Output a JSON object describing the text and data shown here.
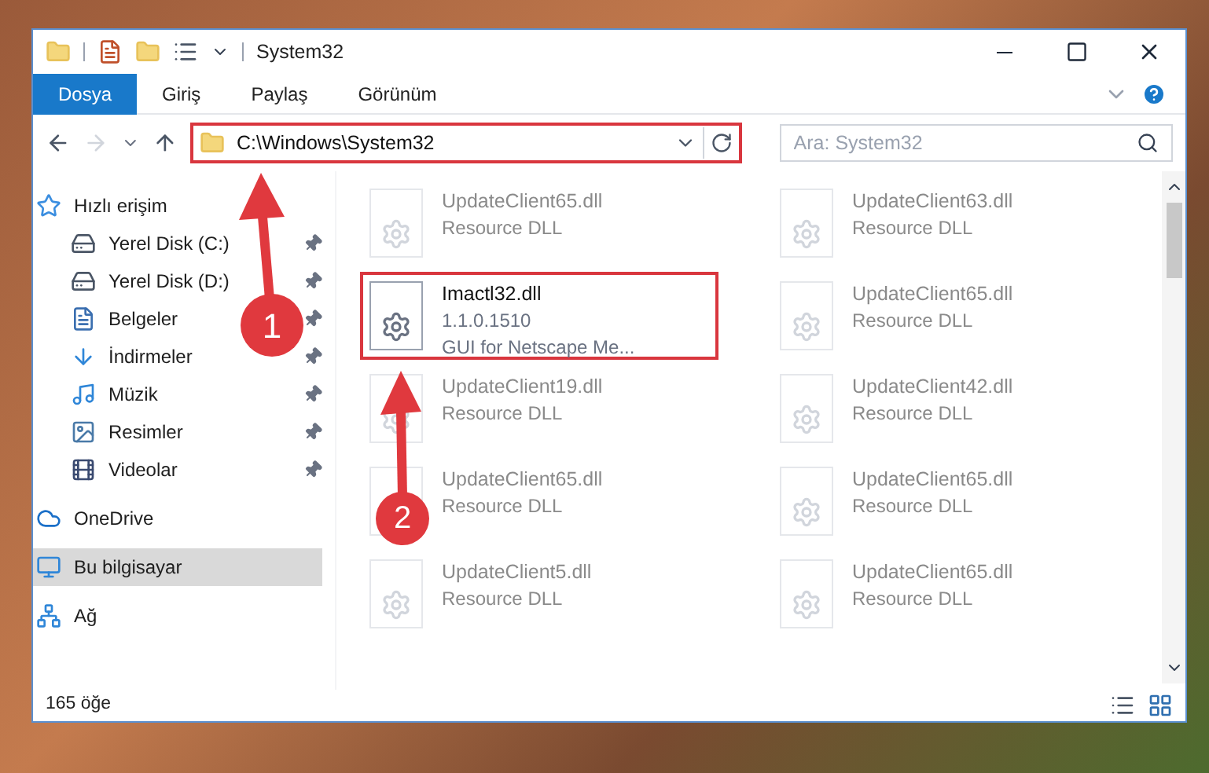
{
  "window": {
    "title": "System32"
  },
  "ribbon_tabs": [
    {
      "label": "Dosya",
      "selected": true
    },
    {
      "label": "Giriş",
      "selected": false
    },
    {
      "label": "Paylaş",
      "selected": false
    },
    {
      "label": "Görünüm",
      "selected": false
    }
  ],
  "address_bar": {
    "path": "C:\\Windows\\System32",
    "highlighted": true
  },
  "search": {
    "placeholder": "Ara: System32"
  },
  "sidebar": {
    "items": [
      {
        "label": "Hızlı erişim",
        "selected": false,
        "children": [
          {
            "label": "Yerel Disk (C:)",
            "pinned": true
          },
          {
            "label": "Yerel Disk (D:)",
            "pinned": true
          },
          {
            "label": "Belgeler",
            "pinned": true
          },
          {
            "label": "İndirmeler",
            "pinned": true
          },
          {
            "label": "Müzik",
            "pinned": true
          },
          {
            "label": "Resimler",
            "pinned": true
          },
          {
            "label": "Videolar",
            "pinned": true
          }
        ]
      },
      {
        "label": "OneDrive",
        "selected": false
      },
      {
        "label": "Bu bilgisayar",
        "selected": true
      },
      {
        "label": "Ağ",
        "selected": false
      }
    ]
  },
  "files": [
    {
      "name": "UpdateClient65.dll",
      "details": [
        "Resource DLL"
      ],
      "dimmed": true,
      "highlighted": false
    },
    {
      "name": "UpdateClient63.dll",
      "details": [
        "Resource DLL"
      ],
      "dimmed": true,
      "highlighted": false
    },
    {
      "name": "Imactl32.dll",
      "details": [
        "1.1.0.1510",
        "GUI for Netscape Me..."
      ],
      "dimmed": false,
      "highlighted": true
    },
    {
      "name": "UpdateClient65.dll",
      "details": [
        "Resource DLL"
      ],
      "dimmed": true,
      "highlighted": false
    },
    {
      "name": "UpdateClient19.dll",
      "details": [
        "Resource DLL"
      ],
      "dimmed": true,
      "highlighted": false
    },
    {
      "name": "UpdateClient42.dll",
      "details": [
        "Resource DLL"
      ],
      "dimmed": true,
      "highlighted": false
    },
    {
      "name": "UpdateClient65.dll",
      "details": [
        "Resource DLL"
      ],
      "dimmed": true,
      "highlighted": false
    },
    {
      "name": "UpdateClient65.dll",
      "details": [
        "Resource DLL"
      ],
      "dimmed": true,
      "highlighted": false
    },
    {
      "name": "UpdateClient5.dll",
      "details": [
        "Resource DLL"
      ],
      "dimmed": true,
      "highlighted": false
    },
    {
      "name": "UpdateClient65.dll",
      "details": [
        "Resource DLL"
      ],
      "dimmed": true,
      "highlighted": false
    }
  ],
  "status_bar": {
    "item_count": "165 öğe"
  },
  "annotations": [
    {
      "number": "1"
    },
    {
      "number": "2"
    }
  ]
}
